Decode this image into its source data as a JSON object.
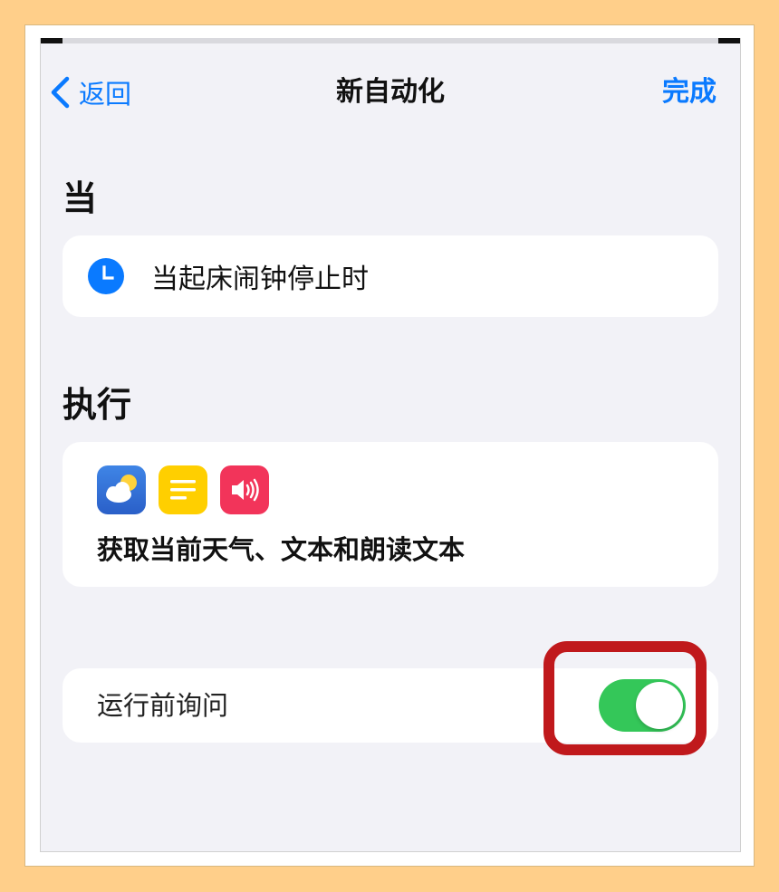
{
  "nav": {
    "back_label": "返回",
    "title": "新自动化",
    "done_label": "完成"
  },
  "when": {
    "section_title": "当",
    "trigger_text": "当起床闹钟停止时"
  },
  "do": {
    "section_title": "执行",
    "app_icons": [
      "weather-icon",
      "notes-icon",
      "speaker-icon"
    ],
    "summary_text": "获取当前天气、文本和朗读文本"
  },
  "ask_before_running": {
    "label": "运行前询问",
    "enabled": true
  },
  "colors": {
    "accent": "#0a7aff",
    "toggle_on": "#34c759",
    "highlight": "#c0191c",
    "background": "#ffcf8a"
  }
}
